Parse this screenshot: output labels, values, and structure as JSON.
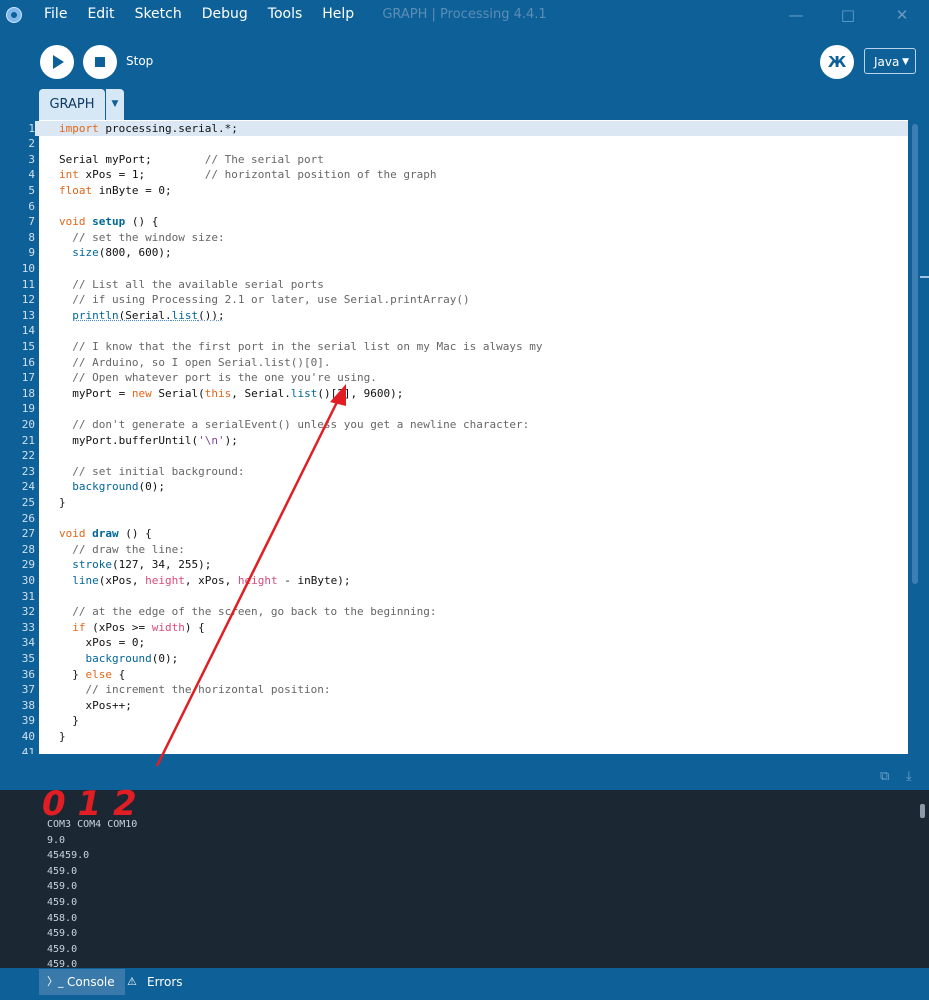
{
  "window": {
    "title": "GRAPH | Processing 4.4.1"
  },
  "menu": [
    "File",
    "Edit",
    "Sketch",
    "Debug",
    "Tools",
    "Help"
  ],
  "toolbar": {
    "stop_label": "Stop",
    "mode": "Java"
  },
  "tabs": [
    {
      "label": "GRAPH"
    }
  ],
  "editor": {
    "current_line": 1,
    "lines": [
      [
        [
          "k",
          "import"
        ],
        [
          "t",
          " processing.serial.*;"
        ]
      ],
      [],
      [
        [
          "t",
          "Serial myPort;        "
        ],
        [
          "c",
          "// The serial port"
        ]
      ],
      [
        [
          "k",
          "int"
        ],
        [
          "t",
          " xPos = 1;         "
        ],
        [
          "c",
          "// horizontal position of the graph"
        ]
      ],
      [
        [
          "k",
          "float"
        ],
        [
          "t",
          " inByte = 0;"
        ]
      ],
      [],
      [
        [
          "k",
          "void"
        ],
        [
          "t",
          " "
        ],
        [
          "fb",
          "setup"
        ],
        [
          "t",
          " () {"
        ]
      ],
      [
        [
          "t",
          "  "
        ],
        [
          "c",
          "// set the window size:"
        ]
      ],
      [
        [
          "t",
          "  "
        ],
        [
          "f",
          "size"
        ],
        [
          "t",
          "(800, 600);"
        ]
      ],
      [],
      [
        [
          "t",
          "  "
        ],
        [
          "c",
          "// List all the available serial ports"
        ]
      ],
      [
        [
          "t",
          "  "
        ],
        [
          "c",
          "// if using Processing 2.1 or later, use Serial.printArray()"
        ]
      ],
      [
        [
          "t",
          "  "
        ],
        [
          "fu",
          "println"
        ],
        [
          "u",
          "(Serial."
        ],
        [
          "fu",
          "list"
        ],
        [
          "u",
          "());"
        ]
      ],
      [],
      [
        [
          "t",
          "  "
        ],
        [
          "c",
          "// I know that the first port in the serial list on my Mac is always my"
        ]
      ],
      [
        [
          "t",
          "  "
        ],
        [
          "c",
          "// Arduino, so I open Serial.list()[0]."
        ]
      ],
      [
        [
          "t",
          "  "
        ],
        [
          "c",
          "// Open whatever port is the one you're using."
        ]
      ],
      [
        [
          "t",
          "  myPort = "
        ],
        [
          "k",
          "new"
        ],
        [
          "t",
          " Serial("
        ],
        [
          "k",
          "this"
        ],
        [
          "t",
          ", Serial."
        ],
        [
          "f",
          "list"
        ],
        [
          "t",
          "()[2], 9600);"
        ]
      ],
      [],
      [
        [
          "t",
          "  "
        ],
        [
          "c",
          "// don't generate a serialEvent() unless you get a newline character:"
        ]
      ],
      [
        [
          "t",
          "  myPort.bufferUntil("
        ],
        [
          "s",
          "'\\n'"
        ],
        [
          "t",
          ");"
        ]
      ],
      [],
      [
        [
          "t",
          "  "
        ],
        [
          "c",
          "// set initial background:"
        ]
      ],
      [
        [
          "t",
          "  "
        ],
        [
          "f",
          "background"
        ],
        [
          "t",
          "(0);"
        ]
      ],
      [
        [
          "t",
          "}"
        ]
      ],
      [],
      [
        [
          "k",
          "void"
        ],
        [
          "t",
          " "
        ],
        [
          "fb",
          "draw"
        ],
        [
          "t",
          " () {"
        ]
      ],
      [
        [
          "t",
          "  "
        ],
        [
          "c",
          "// draw the line:"
        ]
      ],
      [
        [
          "t",
          "  "
        ],
        [
          "f",
          "stroke"
        ],
        [
          "t",
          "(127, 34, 255);"
        ]
      ],
      [
        [
          "t",
          "  "
        ],
        [
          "f",
          "line"
        ],
        [
          "t",
          "(xPos, "
        ],
        [
          "v",
          "height"
        ],
        [
          "t",
          ", xPos, "
        ],
        [
          "v",
          "height"
        ],
        [
          "t",
          " - inByte);"
        ]
      ],
      [],
      [
        [
          "t",
          "  "
        ],
        [
          "c",
          "// at the edge of the screen, go back to the beginning:"
        ]
      ],
      [
        [
          "t",
          "  "
        ],
        [
          "k",
          "if"
        ],
        [
          "t",
          " (xPos >= "
        ],
        [
          "v",
          "width"
        ],
        [
          "t",
          ") {"
        ]
      ],
      [
        [
          "t",
          "    xPos = 0;"
        ]
      ],
      [
        [
          "t",
          "    "
        ],
        [
          "f",
          "background"
        ],
        [
          "t",
          "(0);"
        ]
      ],
      [
        [
          "t",
          "  } "
        ],
        [
          "k",
          "else"
        ],
        [
          "t",
          " {"
        ]
      ],
      [
        [
          "t",
          "    "
        ],
        [
          "c",
          "// increment the horizontal position:"
        ]
      ],
      [
        [
          "t",
          "    xPos++;"
        ]
      ],
      [
        [
          "t",
          "  }"
        ]
      ],
      [
        [
          "t",
          "}"
        ]
      ],
      []
    ]
  },
  "annotation": {
    "text": "0 1 2",
    "color": "#e01e24"
  },
  "console": {
    "lines": [
      "COM3 COM4 COM10",
      "9.0",
      "45459.0",
      "459.0",
      "459.0",
      "459.0",
      "458.0",
      "459.0",
      "459.0",
      "459.0"
    ]
  },
  "footer": {
    "console_label": "Console",
    "errors_label": "Errors"
  }
}
